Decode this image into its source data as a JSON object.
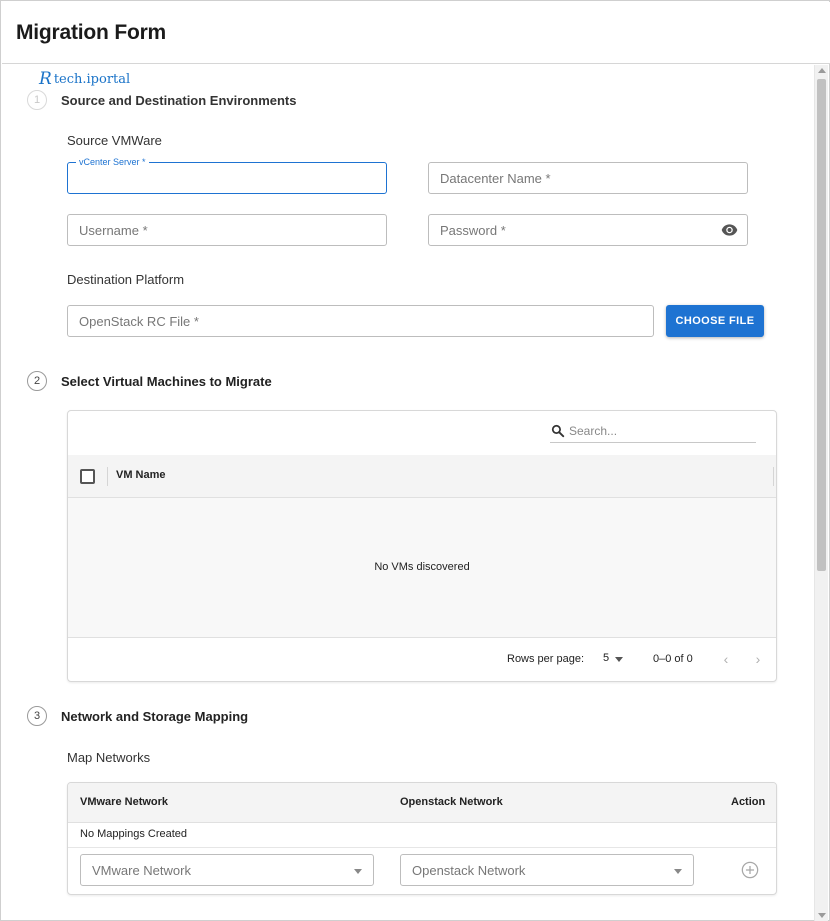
{
  "header": {
    "title": "Migration Form"
  },
  "watermark": {
    "text": "tech.iportal",
    "icon": "R"
  },
  "steps": [
    {
      "number": "1",
      "title": "Source and Destination Environments"
    },
    {
      "number": "2",
      "title": "Select Virtual Machines to Migrate"
    },
    {
      "number": "3",
      "title": "Network and Storage Mapping"
    }
  ],
  "source": {
    "section_label": "Source VMWare",
    "vcenter": {
      "label": "vCenter Server *",
      "value": ""
    },
    "datacenter": {
      "placeholder": "Datacenter Name *"
    },
    "username": {
      "placeholder": "Username *"
    },
    "password": {
      "placeholder": "Password *"
    }
  },
  "destination": {
    "section_label": "Destination Platform",
    "rc_file": {
      "placeholder": "OpenStack RC File *"
    },
    "choose_file_label": "CHOOSE FILE"
  },
  "vm_table": {
    "search_placeholder": "Search...",
    "columns": [
      "VM Name"
    ],
    "rows": [],
    "empty_message": "No VMs discovered",
    "pagination": {
      "rows_per_page_label": "Rows per page:",
      "rows_per_page_value": "5",
      "range": "0–0 of 0",
      "prev": "‹",
      "next": "›"
    }
  },
  "mapping": {
    "section_label": "Map Networks",
    "columns": [
      "VMware Network",
      "Openstack Network",
      "Action"
    ],
    "empty_message": "No Mappings Created",
    "vmware_select_placeholder": "VMware Network",
    "openstack_select_placeholder": "Openstack Network"
  },
  "colors": {
    "accent": "#1e73d2",
    "watermark": "#1a73c8",
    "table_header_bg": "#f4f4f4"
  }
}
